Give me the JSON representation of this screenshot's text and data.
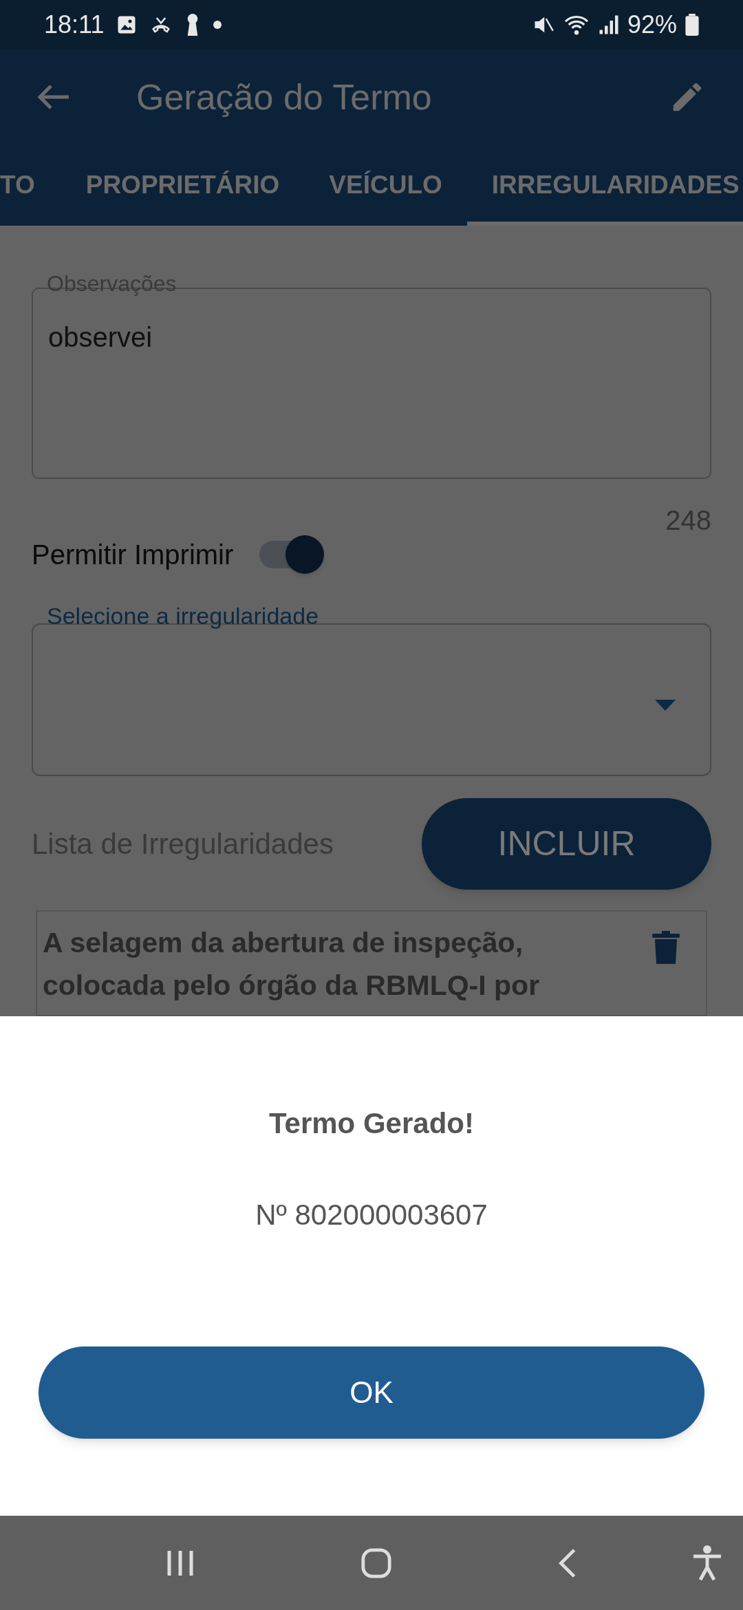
{
  "status_bar": {
    "time": "18:11",
    "battery": "92%"
  },
  "app_bar": {
    "title": "Geração do Termo"
  },
  "tabs": [
    {
      "label": "TO",
      "selected": false
    },
    {
      "label": "PROPRIETÁRIO",
      "selected": false
    },
    {
      "label": "VEÍCULO",
      "selected": false
    },
    {
      "label": "IRREGULARIDADES",
      "selected": true
    }
  ],
  "form": {
    "observations": {
      "label": "Observações",
      "value": "observei"
    },
    "char_count": "248",
    "print_toggle": {
      "label": "Permitir Imprimir",
      "on": true
    },
    "irregularity_select": {
      "label": "Selecione a irregularidade"
    }
  },
  "list": {
    "title": "Lista de Irregularidades",
    "add_button": "INCLUIR",
    "items": [
      {
        "text": "A selagem da abertura de inspeção, colocada pelo órgão da RBMLQ-I por"
      }
    ]
  },
  "dialog": {
    "title": "Termo Gerado!",
    "number": "Nº 802000003607",
    "ok_button": "OK"
  }
}
